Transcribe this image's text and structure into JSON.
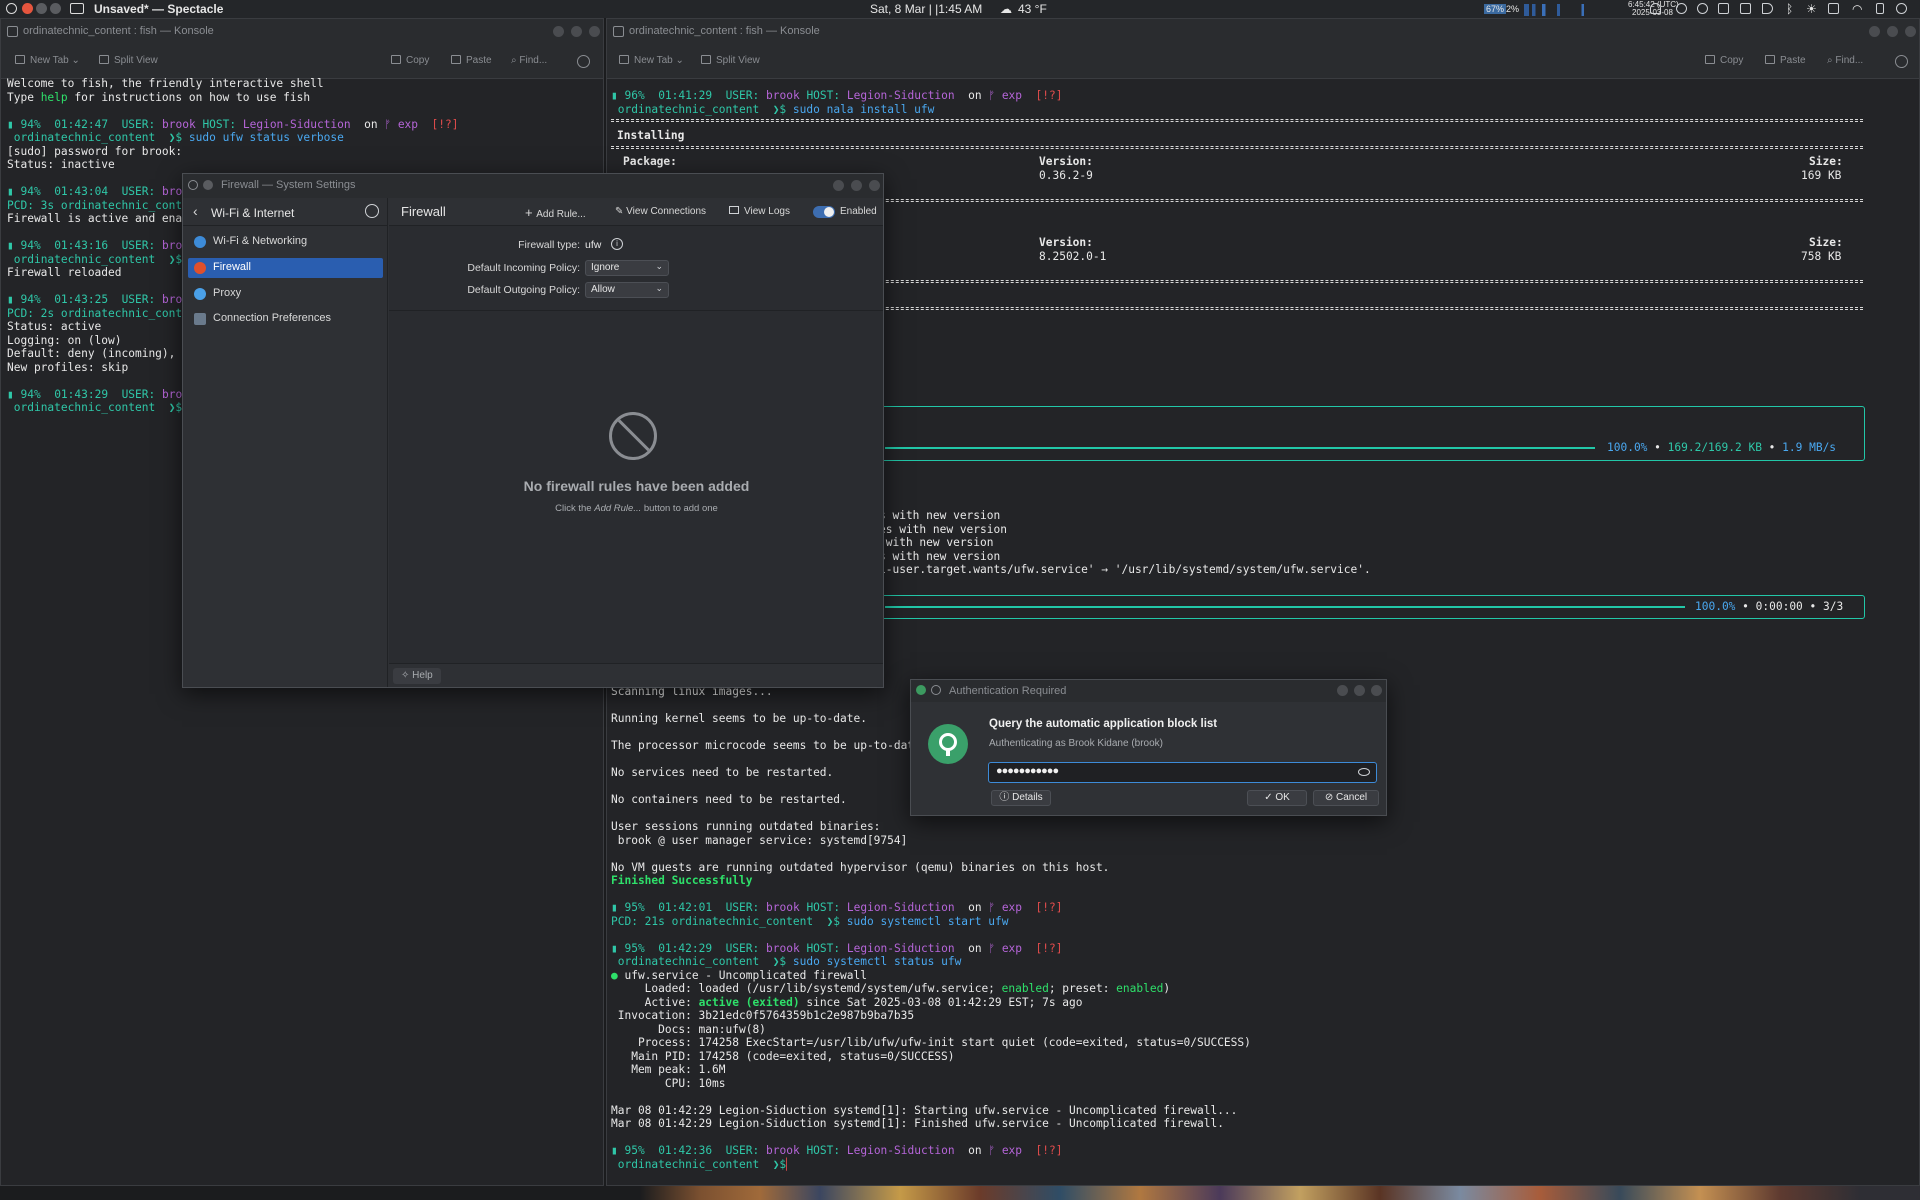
{
  "panel": {
    "app_title": "Unsaved* — Spectacle",
    "clock": "Sat, 8 Mar |  |1:45 AM",
    "weather": "43 °F",
    "cpu1": "67%",
    "cpu2": "2%",
    "utc_time": "6:45:42 (UTC)",
    "utc_date": "2025-03-08"
  },
  "left_konsole": {
    "title": "ordinatechnic_content : fish — Konsole",
    "toolbar": {
      "new_tab": "New Tab",
      "split_view": "Split View",
      "copy": "Copy",
      "paste": "Paste",
      "find": "Find..."
    }
  },
  "right_konsole": {
    "title": "ordinatechnic_content : fish — Konsole",
    "toolbar": {
      "new_tab": "New Tab",
      "split_view": "Split View",
      "copy": "Copy",
      "paste": "Paste",
      "find": "Find..."
    }
  },
  "left_terminal": {
    "welcome1": "Welcome to fish, the friendly interactive shell",
    "welcome2a": "Type ",
    "welcome2b": "help",
    "welcome2c": " for instructions on how to use fish",
    "p1_batt": "94%",
    "p1_time": "01:42:47",
    "p1_user_lbl": "USER:",
    "p1_user": "brook",
    "p1_host_lbl": "HOST:",
    "p1_host": "Legion-Siduction",
    "p1_on": "on",
    "p1_branch": "ᚠ exp",
    "p1_status": "[!?]",
    "p1_dir": "ordinatechnic_content",
    "p1_arrow": "❯$",
    "p1_cmd": "sudo ufw status verbose",
    "sudo_pw": "[sudo] password for brook:",
    "status_inactive": "Status: inactive",
    "p2_batt": "94%",
    "p2_time": "01:43:04",
    "p2_user_lbl": "USER:",
    "p2_user": "bro",
    "p2_line2": "PCD: 3s ordinatechnic_cont",
    "fw_active": "Firewall is active and ena",
    "p3_batt": "94%",
    "p3_time": "01:43:16",
    "p3_user_lbl": "USER:",
    "p3_user": "bro",
    "p3_dir": "ordinatechnic_content",
    "p3_arrow": "❯$",
    "fw_reloaded": "Firewall reloaded",
    "p4_batt": "94%",
    "p4_time": "01:43:25",
    "p4_user_lbl": "USER:",
    "p4_user": "bro",
    "p4_line2": "PCD: 2s ordinatechnic_cont",
    "status_active": "Status: active",
    "logging": "Logging: on (low)",
    "default": "Default: deny (incoming),",
    "new_profiles": "New profiles: skip",
    "p5_batt": "94%",
    "p5_time": "01:43:29",
    "p5_user_lbl": "USER:",
    "p5_user": "broo",
    "p5_dir": "ordinatechnic_content",
    "p5_arrow": "❯$"
  },
  "right_terminal": {
    "p1_batt": "96%",
    "p1_time": "01:41:29",
    "p1_user_lbl": "USER:",
    "p1_user": "brook",
    "p1_host_lbl": "HOST:",
    "p1_host": "Legion-Siduction",
    "p1_on": "on",
    "p1_branch": "ᚠ exp",
    "p1_status": "[!?]",
    "p1_dir": "ordinatechnic_content",
    "p1_arrow": "❯$",
    "p1_cmd": "sudo nala install ufw",
    "installing": "Installing",
    "package_hdr": "Package:",
    "version_hdr": "Version:",
    "size_hdr": "Size:",
    "pkg1_version": "0.36.2-9",
    "pkg1_size": "169 KB",
    "version_hdr2": "Version:",
    "size_hdr2": "Size:",
    "pkg2_version": "8.2502.0-1",
    "pkg2_size": "758 KB",
    "dl_pct": "100.0%",
    "dl_amount": "169.2/169.2 KB",
    "dl_speed": "1.9 MB/s",
    "cfg1": "s with new version",
    "cfg2": "es with new version",
    "cfg3": " with new version",
    "cfg4": "s with new version",
    "symlink": "i-user.target.wants/ufw.service' → '/usr/lib/systemd/system/ufw.service'.",
    "paren": ")",
    "inst_pct": "100.0%",
    "inst_time": "0:00:00",
    "inst_count": "3/3",
    "scanning": "Scanning linux images...",
    "kernel": "Running kernel seems to be up-to-date.",
    "microcode": "The processor microcode seems to be up-to-dat",
    "no_services": "No services need to be restarted.",
    "no_containers": "No containers need to be restarted.",
    "sessions": "User sessions running outdated binaries:",
    "sessions_detail": " brook @ user manager service: systemd[9754]",
    "no_vm": "No VM guests are running outdated hypervisor (qemu) binaries on this host.",
    "finished": "Finished Successfully",
    "p2_batt": "95%",
    "p2_time": "01:42:01",
    "p2_user_lbl": "USER:",
    "p2_user": "brook",
    "p2_host_lbl": "HOST:",
    "p2_host": "Legion-Siduction",
    "p2_on": "on",
    "p2_branch": "ᚠ exp",
    "p2_status": "[!?]",
    "p2_pcd": "PCD: 21s ordinatechnic_content",
    "p2_arrow": "❯$",
    "p2_cmd": "sudo systemctl start ufw",
    "p3_batt": "95%",
    "p3_time": "01:42:29",
    "p3_user_lbl": "USER:",
    "p3_user": "brook",
    "p3_host_lbl": "HOST:",
    "p3_host": "Legion-Siduction",
    "p3_on": "on",
    "p3_branch": "ᚠ exp",
    "p3_status": "[!?]",
    "p3_dir": "ordinatechnic_content",
    "p3_arrow": "❯$",
    "p3_cmd": "sudo systemctl status ufw",
    "svc_dot": "●",
    "svc_name": " ufw.service - Uncomplicated firewall",
    "loaded_pre": "     Loaded: loaded (/usr/lib/systemd/system/ufw.service; ",
    "loaded_enabled": "enabled",
    "loaded_mid": "; preset: ",
    "loaded_preset": "enabled",
    "loaded_post": ")",
    "active_pre": "     Active: ",
    "active_state": "active (exited)",
    "active_post": " since Sat 2025-03-08 01:42:29 EST; 7s ago",
    "invocation": " Invocation: 3b21edc0f5764359b1c2e987b9ba7b35",
    "docs": "       Docs: man:ufw(8)",
    "process": "    Process: 174258 ExecStart=/usr/lib/ufw/ufw-init start quiet (code=exited, status=0/SUCCESS)",
    "mainpid": "   Main PID: 174258 (code=exited, status=0/SUCCESS)",
    "mempeak": "   Mem peak: 1.6M",
    "cpu": "        CPU: 10ms",
    "log1": "Mar 08 01:42:29 Legion-Siduction systemd[1]: Starting ufw.service - Uncomplicated firewall...",
    "log2": "Mar 08 01:42:29 Legion-Siduction systemd[1]: Finished ufw.service - Uncomplicated firewall.",
    "p4_batt": "95%",
    "p4_time": "01:42:36",
    "p4_user_lbl": "USER:",
    "p4_user": "brook",
    "p4_host_lbl": "HOST:",
    "p4_host": "Legion-Siduction",
    "p4_on": "on",
    "p4_branch": "ᚠ exp",
    "p4_status": "[!?]",
    "p4_dir": "ordinatechnic_content",
    "p4_arrow": "❯$"
  },
  "firewall_window": {
    "title": "Firewall — System Settings",
    "sidebar_header": "Wi-Fi & Internet",
    "sidebar_items": [
      {
        "label": "Wi-Fi & Networking"
      },
      {
        "label": "Firewall"
      },
      {
        "label": "Proxy"
      },
      {
        "label": "Connection Preferences"
      }
    ],
    "page_title": "Firewall",
    "add_rule": "Add Rule...",
    "view_connections": "View Connections",
    "view_logs": "View Logs",
    "enabled_label": "Enabled",
    "firewall_type_label": "Firewall type:",
    "firewall_type_value": "ufw",
    "incoming_label": "Default Incoming Policy:",
    "incoming_value": "Ignore",
    "outgoing_label": "Default Outgoing Policy:",
    "outgoing_value": "Allow",
    "empty_title": "No firewall rules have been added",
    "empty_hint_pre": "Click the ",
    "empty_hint_em": "Add Rule...",
    "empty_hint_post": " button to add one",
    "help": "Help"
  },
  "auth_dialog": {
    "title": "Authentication Required",
    "heading": "Query the automatic application block list",
    "subtitle": "Authenticating as Brook Kidane (brook)",
    "password_mask": "●●●●●●●●●●●",
    "details": "Details",
    "ok": "OK",
    "cancel": "Cancel"
  }
}
